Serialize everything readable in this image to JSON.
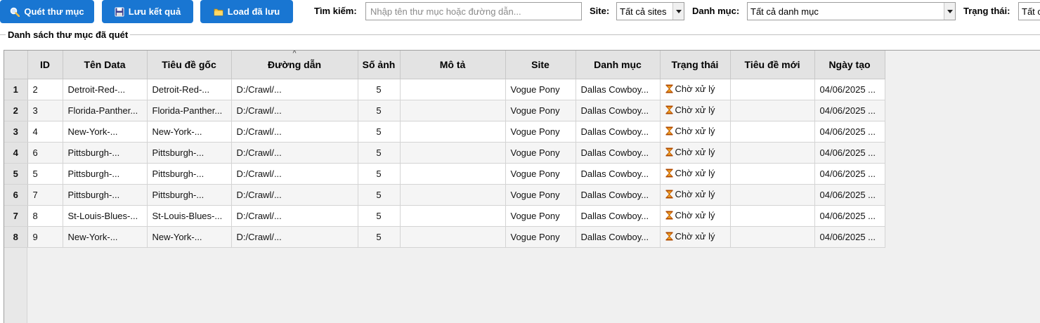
{
  "toolbar": {
    "scan_label": "Quét thư mục",
    "save_label": "Lưu kết quả",
    "load_label": "Load đã lưu",
    "search_label": "Tìm kiếm:",
    "search_placeholder": "Nhập tên thư mục hoặc đường dẫn...",
    "site_label": "Site:",
    "site_value": "Tất cả sites",
    "category_label": "Danh mục:",
    "category_value": "Tất cả danh mục",
    "status_label": "Trạng thái:",
    "status_value": "Tất c"
  },
  "group_title": "Danh sách thư mục đã quét",
  "table": {
    "columns": [
      "ID",
      "Tên Data",
      "Tiêu đề gốc",
      "Đường dẫn",
      "Số ảnh",
      "Mô tả",
      "Site",
      "Danh mục",
      "Trạng thái",
      "Tiêu đề mới",
      "Ngày tạo"
    ],
    "sorted_column": "Đường dẫn",
    "rows": [
      {
        "row": "1",
        "id": "2",
        "name": "Detroit-Red-...",
        "orig_title": "Detroit-Red-...",
        "path": "D:/Crawl/...",
        "images": "5",
        "desc": "",
        "site": "Vogue Pony",
        "category": "Dallas Cowboy...",
        "status": "Chờ xử lý",
        "new_title": "",
        "created": "04/06/2025 ..."
      },
      {
        "row": "2",
        "id": "3",
        "name": "Florida-Panther...",
        "orig_title": "Florida-Panther...",
        "path": "D:/Crawl/...",
        "images": "5",
        "desc": "",
        "site": "Vogue Pony",
        "category": "Dallas Cowboy...",
        "status": "Chờ xử lý",
        "new_title": "",
        "created": "04/06/2025 ..."
      },
      {
        "row": "3",
        "id": "4",
        "name": "New-York-...",
        "orig_title": "New-York-...",
        "path": "D:/Crawl/...",
        "images": "5",
        "desc": "",
        "site": "Vogue Pony",
        "category": "Dallas Cowboy...",
        "status": "Chờ xử lý",
        "new_title": "",
        "created": "04/06/2025 ..."
      },
      {
        "row": "4",
        "id": "6",
        "name": "Pittsburgh-...",
        "orig_title": "Pittsburgh-...",
        "path": "D:/Crawl/...",
        "images": "5",
        "desc": "",
        "site": "Vogue Pony",
        "category": "Dallas Cowboy...",
        "status": "Chờ xử lý",
        "new_title": "",
        "created": "04/06/2025 ..."
      },
      {
        "row": "5",
        "id": "5",
        "name": "Pittsburgh-...",
        "orig_title": "Pittsburgh-...",
        "path": "D:/Crawl/...",
        "images": "5",
        "desc": "",
        "site": "Vogue Pony",
        "category": "Dallas Cowboy...",
        "status": "Chờ xử lý",
        "new_title": "",
        "created": "04/06/2025 ..."
      },
      {
        "row": "6",
        "id": "7",
        "name": "Pittsburgh-...",
        "orig_title": "Pittsburgh-...",
        "path": "D:/Crawl/...",
        "images": "5",
        "desc": "",
        "site": "Vogue Pony",
        "category": "Dallas Cowboy...",
        "status": "Chờ xử lý",
        "new_title": "",
        "created": "04/06/2025 ..."
      },
      {
        "row": "7",
        "id": "8",
        "name": "St-Louis-Blues-...",
        "orig_title": "St-Louis-Blues-...",
        "path": "D:/Crawl/...",
        "images": "5",
        "desc": "",
        "site": "Vogue Pony",
        "category": "Dallas Cowboy...",
        "status": "Chờ xử lý",
        "new_title": "",
        "created": "04/06/2025 ..."
      },
      {
        "row": "8",
        "id": "9",
        "name": "New-York-...",
        "orig_title": "New-York-...",
        "path": "D:/Crawl/...",
        "images": "5",
        "desc": "",
        "site": "Vogue Pony",
        "category": "Dallas Cowboy...",
        "status": "Chờ xử lý",
        "new_title": "",
        "created": "04/06/2025 ..."
      }
    ]
  },
  "icons": {
    "scan": "magnifier-icon",
    "save": "floppy-disk-icon",
    "load": "folder-icon",
    "status": "hourglass-icon"
  },
  "colors": {
    "button_bg": "#1976d2",
    "header_bg": "#e3e3e3",
    "hourglass": "#d35400"
  }
}
